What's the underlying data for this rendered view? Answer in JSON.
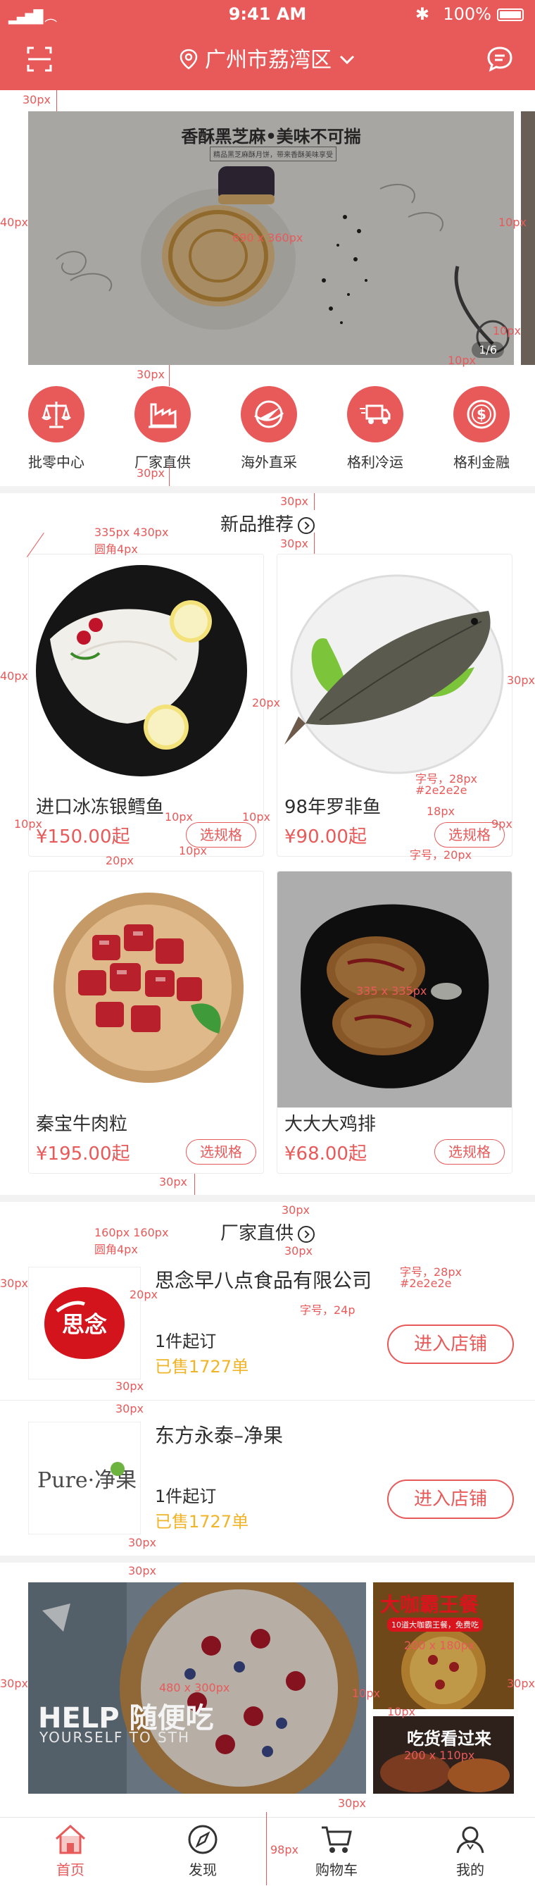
{
  "status_bar": {
    "time": "9:41 AM",
    "battery": "100%"
  },
  "header": {
    "city": "广州市荔湾区",
    "accent": "#e85a5a"
  },
  "banner": {
    "title": "香酥黑芝麻•美味不可揣",
    "subtitle": "精品黑芝麻酥月饼，带来香酥美味享受",
    "pager": "1/6",
    "size_note": "690 x 360px"
  },
  "quick_nav": [
    {
      "icon": "scale-icon",
      "label": "批零中心"
    },
    {
      "icon": "factory-icon",
      "label": "厂家直供"
    },
    {
      "icon": "plane-icon",
      "label": "海外直采"
    },
    {
      "icon": "truck-icon",
      "label": "格利冷运"
    },
    {
      "icon": "dollar-coin-icon",
      "label": "格利金融"
    }
  ],
  "new_products": {
    "title": "新品推荐",
    "spec_button": "选规格",
    "items": [
      {
        "name": "进口冰冻银鳕鱼",
        "price": "¥150.00起"
      },
      {
        "name": "98年罗非鱼",
        "price": "¥90.00起"
      },
      {
        "name": "秦宝牛肉粒",
        "price": "¥195.00起"
      },
      {
        "name": "大大大鸡排",
        "price": "¥68.00起"
      }
    ]
  },
  "vendors": {
    "title": "厂家直供",
    "enter_button": "进入店铺",
    "items": [
      {
        "name": "思念早八点食品有限公司",
        "logo_text": "思念",
        "moq": "1件起订",
        "sold": "已售1727单"
      },
      {
        "name": "东方永泰–净果",
        "logo_text": "Pure·净果",
        "moq": "1件起订",
        "sold": "已售1727单"
      }
    ]
  },
  "promos": {
    "big_title": "HELP 随便吃",
    "big_sub": "YOURSELF TO STH",
    "top_right": "大咖霸王餐",
    "top_right_sub": "10道大咖霸王餐，免费吃",
    "bottom_right": "吃货看过来"
  },
  "tabbar": [
    {
      "icon": "home-icon",
      "label": "首页",
      "active": true
    },
    {
      "icon": "compass-icon",
      "label": "发现",
      "active": false
    },
    {
      "icon": "cart-icon",
      "label": "购物车",
      "active": false
    },
    {
      "icon": "user-icon",
      "label": "我的",
      "active": false
    }
  ],
  "annotations": {
    "p30": "30px",
    "p40": "40px",
    "p20": "20px",
    "p10": "10px",
    "p18": "18px",
    "p9": "9px",
    "p98": "98px",
    "card_size": "335px 430px",
    "card_radius": "圆角4px",
    "font28": "字号，28px",
    "color_main": "#2e2e2e",
    "font20": "字号，20px",
    "font24": "字号，24p",
    "logo_size": "160px 160px",
    "logo_radius": "圆角4px",
    "img_335": "335 x 335px",
    "img_480": "480 x 300px",
    "img_200a": "200 x 180px",
    "img_200b": "200 x 110px"
  }
}
